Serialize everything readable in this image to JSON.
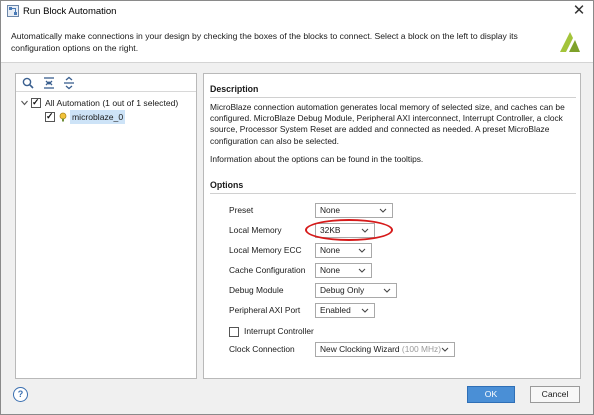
{
  "window": {
    "title": "Run Block Automation",
    "close_glyph": "✕",
    "app_icon": "automation-app-icon",
    "brand_logo": "brand-logo"
  },
  "intro": "Automatically make connections in your design by checking the boxes of the blocks to connect. Select a block on the left to display its configuration options on the right.",
  "left_panel": {
    "toolbar": [
      {
        "name": "search-icon",
        "tooltip": ""
      },
      {
        "name": "collapse-all-icon",
        "tooltip": ""
      },
      {
        "name": "expand-all-icon",
        "tooltip": ""
      }
    ],
    "tree": [
      {
        "label": "All Automation (1 out of 1 selected)",
        "checked": true,
        "expanded": true,
        "level": 0
      },
      {
        "label": "microblaze_0",
        "checked": true,
        "selected": true,
        "level": 1,
        "icon": "microblaze-chip-icon"
      }
    ]
  },
  "right_panel": {
    "description_title": "Description",
    "description": "MicroBlaze connection automation generates local memory of selected size, and caches can be configured. MicroBlaze Debug Module, Peripheral AXI interconnect, Interrupt Controller, a clock source, Processor System Reset are added and connected as needed. A preset MicroBlaze configuration can also be selected.",
    "info": "Information about the options can be found in the tooltips.",
    "options_title": "Options",
    "options": [
      {
        "label": "Preset",
        "value": "None"
      },
      {
        "label": "Local Memory",
        "value": "32KB"
      },
      {
        "label": "Local Memory ECC",
        "value": "None"
      },
      {
        "label": "Cache Configuration",
        "value": "None"
      },
      {
        "label": "Debug Module",
        "value": "Debug Only"
      },
      {
        "label": "Peripheral AXI Port",
        "value": "Enabled"
      }
    ],
    "interrupt_controller": {
      "label": "Interrupt Controller",
      "checked": false
    },
    "clock_connection": {
      "label": "Clock Connection",
      "value": "New Clocking Wizard",
      "hint": "(100 MHz)"
    }
  },
  "footer": {
    "help_label": "?",
    "ok_label": "OK",
    "cancel_label": "Cancel"
  },
  "annotation": {
    "color": "#d61a1a",
    "target": "Local Memory"
  }
}
